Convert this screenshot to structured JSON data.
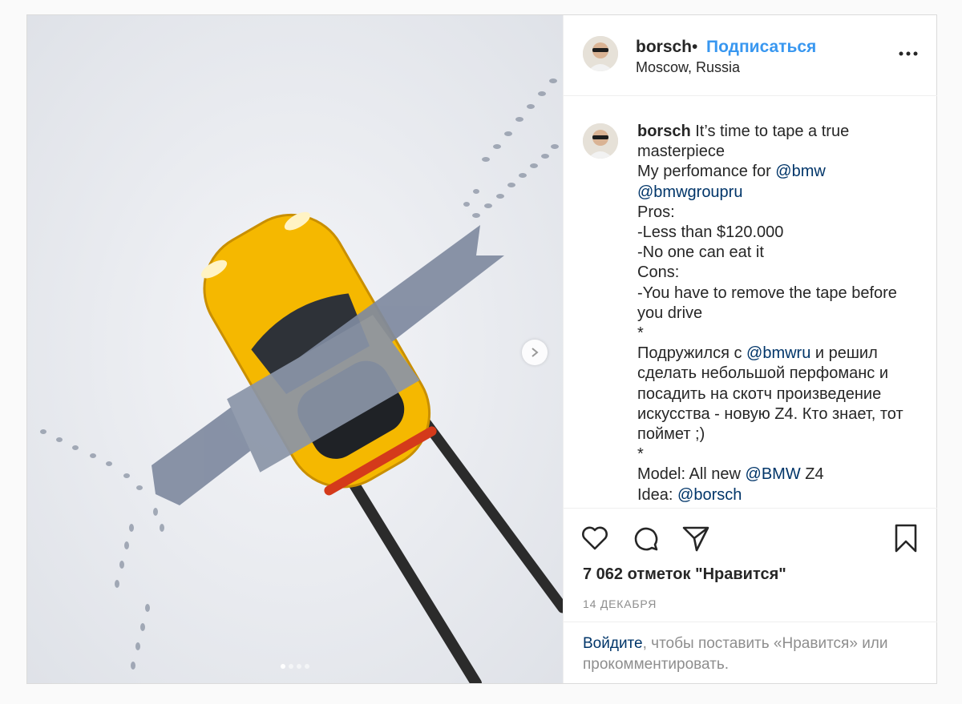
{
  "post": {
    "username": "borsch",
    "separator": "•",
    "follow_label": "Подписаться",
    "location": "Moscow, Russia"
  },
  "caption": {
    "author": "borsch",
    "lines": [
      {
        "parts": [
          {
            "t": "It’s time to tape a true"
          }
        ]
      },
      {
        "parts": [
          {
            "t": "masterpiece"
          }
        ]
      },
      {
        "parts": [
          {
            "t": "My perfomance for "
          },
          {
            "t": "@bmw",
            "m": true
          }
        ]
      },
      {
        "parts": [
          {
            "t": "@bmwgroupru",
            "m": true
          }
        ]
      },
      {
        "parts": [
          {
            "t": "Pros:"
          }
        ]
      },
      {
        "parts": [
          {
            "t": "-Less than $120.000"
          }
        ]
      },
      {
        "parts": [
          {
            "t": "-No one can eat it"
          }
        ]
      },
      {
        "parts": [
          {
            "t": "Cons:"
          }
        ]
      },
      {
        "parts": [
          {
            "t": "-You have to remove the tape before"
          }
        ]
      },
      {
        "parts": [
          {
            "t": "you drive"
          }
        ]
      },
      {
        "parts": [
          {
            "t": "*"
          }
        ]
      },
      {
        "parts": [
          {
            "t": "Подружился с "
          },
          {
            "t": "@bmwru",
            "m": true
          },
          {
            "t": " и решил"
          }
        ]
      },
      {
        "parts": [
          {
            "t": "сделать небольшой перфоманс и"
          }
        ]
      },
      {
        "parts": [
          {
            "t": "посадить на скотч произведение"
          }
        ]
      },
      {
        "parts": [
          {
            "t": "искусства - новую Z4. Кто знает, тот"
          }
        ]
      },
      {
        "parts": [
          {
            "t": "поймет ;)"
          }
        ]
      },
      {
        "parts": [
          {
            "t": "*"
          }
        ]
      },
      {
        "parts": [
          {
            "t": "Model: All new "
          },
          {
            "t": "@BMW",
            "m": true
          },
          {
            "t": " Z4"
          }
        ]
      },
      {
        "parts": [
          {
            "t": "Idea: "
          },
          {
            "t": "@borsch",
            "m": true
          }
        ]
      }
    ]
  },
  "stats": {
    "likes": "7 062 отметок \"Нравится\"",
    "date": "14 ДЕКАБРЯ"
  },
  "login_prompt": {
    "link": "Войдите",
    "rest": ", чтобы поставить «Нравится» или прокомментировать."
  },
  "carousel": {
    "count": 4,
    "active": 0
  },
  "icons": [
    "heart-icon",
    "comment-icon",
    "share-icon",
    "bookmark-icon",
    "more-icon",
    "chevron-right-icon"
  ],
  "colors": {
    "link": "#3897f0",
    "mention": "#003569",
    "car": "#f5b800",
    "tape": "#7f8aa0"
  }
}
